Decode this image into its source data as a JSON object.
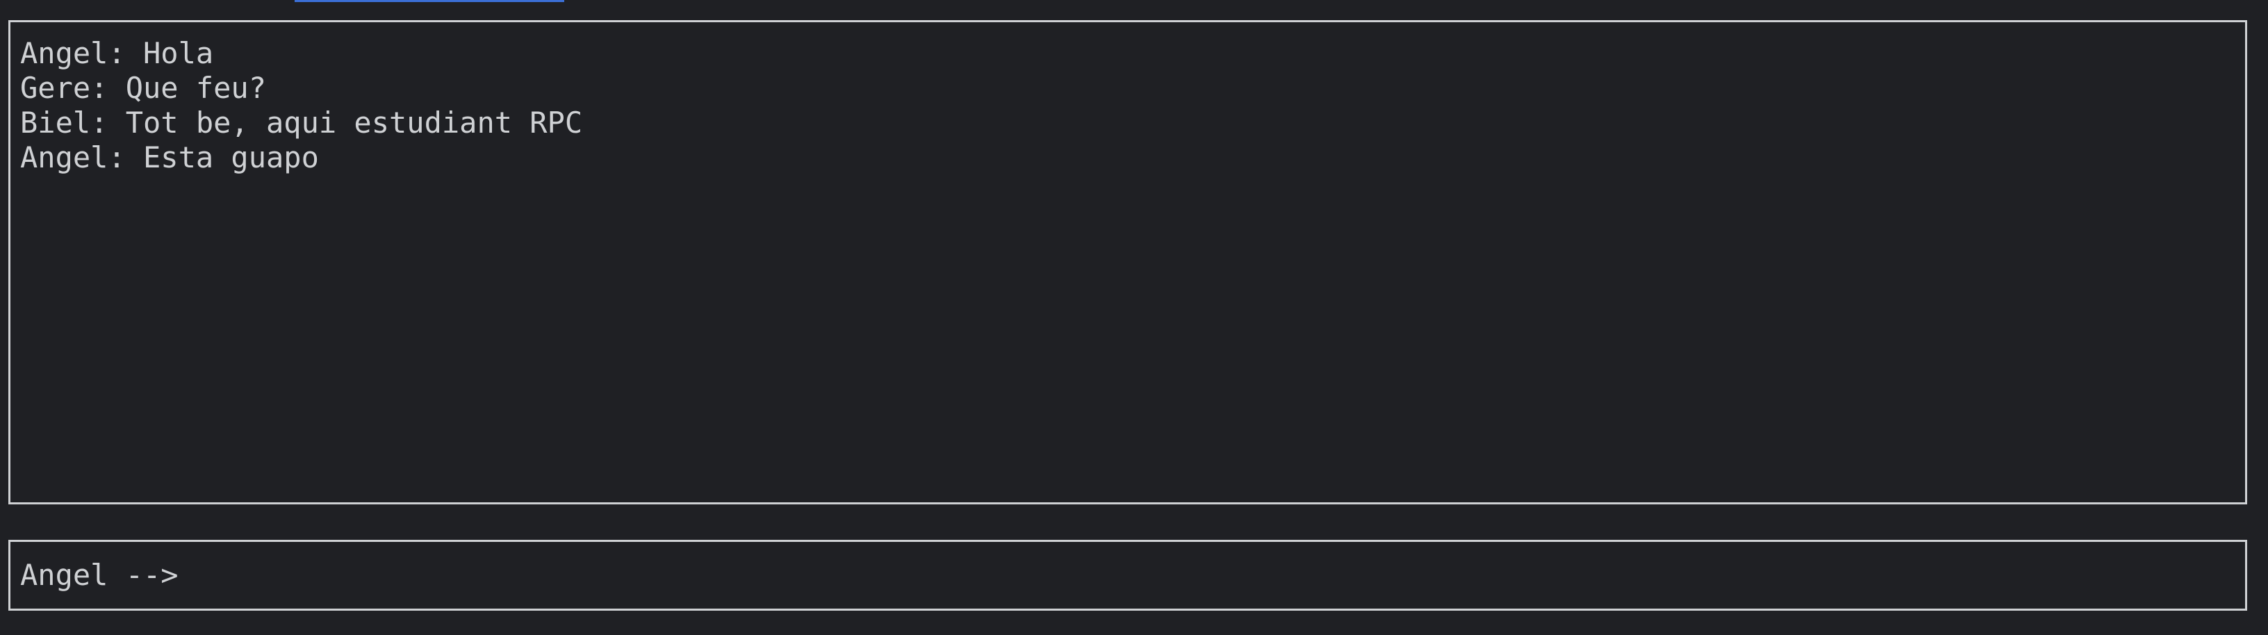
{
  "colors": {
    "background": "#1f2024",
    "foreground": "#cfd1d4",
    "border": "#cfd1d4",
    "accent": "#3b6fd6"
  },
  "chat": {
    "messages": [
      "Angel: Hola",
      "Gere: Que feu?",
      "Biel: Tot be, aqui estudiant RPC",
      "Angel: Esta guapo"
    ]
  },
  "input": {
    "prompt": "Angel -->",
    "value": ""
  }
}
